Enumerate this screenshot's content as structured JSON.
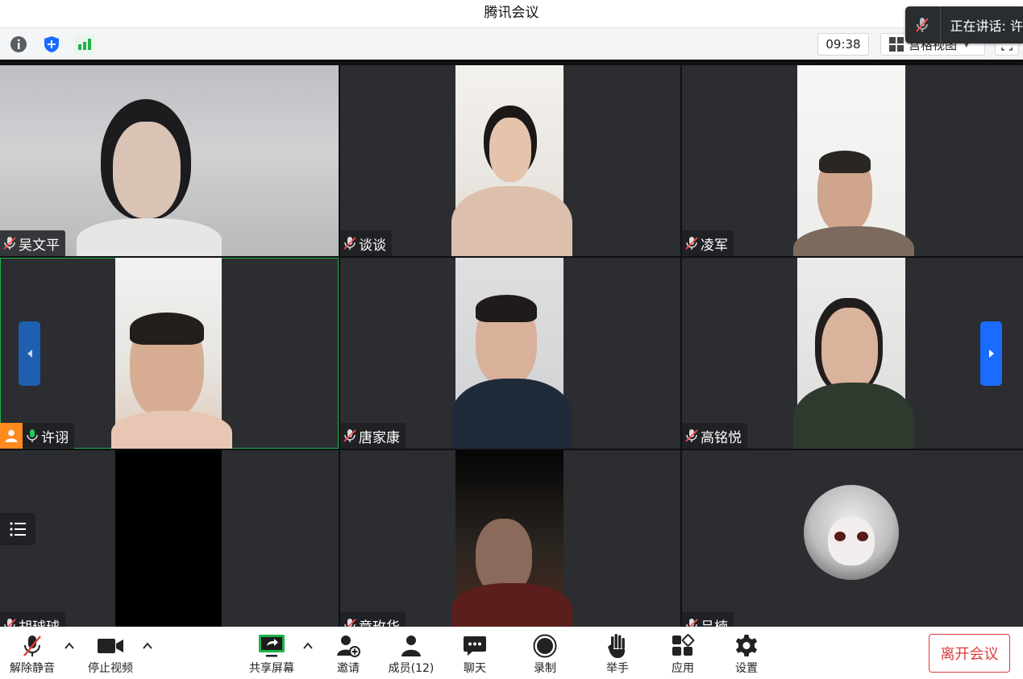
{
  "window": {
    "title": "腾讯会议"
  },
  "speaking_banner": {
    "label": "正在讲话: 许"
  },
  "toolbar": {
    "time": "09:38",
    "view_label": "宫格视图"
  },
  "participants": [
    {
      "name": "吴文平",
      "muted": true
    },
    {
      "name": "谈谈",
      "muted": true
    },
    {
      "name": "凌军",
      "muted": true
    },
    {
      "name": "许诩",
      "muted": false,
      "host": true,
      "active": true
    },
    {
      "name": "唐家康",
      "muted": true
    },
    {
      "name": "高铭悦",
      "muted": true
    },
    {
      "name": "胡球球",
      "muted": true
    },
    {
      "name": "章玫华",
      "muted": true
    },
    {
      "name": "吕楠",
      "muted": true
    }
  ],
  "bottombar": {
    "unmute": "解除静音",
    "stop_video": "停止视频",
    "share_screen": "共享屏幕",
    "invite": "邀请",
    "members": "成员(12)",
    "chat": "聊天",
    "record": "录制",
    "raise_hand": "举手",
    "apps": "应用",
    "settings": "设置",
    "leave": "离开会议"
  },
  "colors": {
    "accent": "#1a6cff",
    "active_border": "#20b34a",
    "host_badge": "#ff8a1f",
    "leave": "#e03a3a"
  }
}
